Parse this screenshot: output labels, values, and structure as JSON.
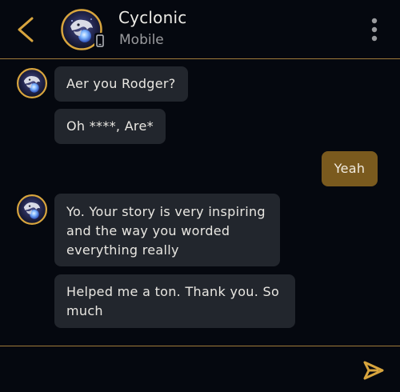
{
  "header": {
    "contact_name": "Cyclonic",
    "contact_status": "Mobile"
  },
  "messages": [
    {
      "direction": "in",
      "text": "Aer you Rodger?"
    },
    {
      "direction": "in",
      "text": "Oh ****, Are*"
    },
    {
      "direction": "out",
      "text": "Yeah"
    },
    {
      "direction": "in",
      "text": "Yo. Your story is very inspiring\nand the way you worded\neverything really"
    },
    {
      "direction": "in",
      "text": "Helped me a ton. Thank you. So\nmuch"
    }
  ],
  "composer": {
    "value": "",
    "placeholder": ""
  },
  "colors": {
    "background": "#05080f",
    "accent": "#d8a53e",
    "incoming_bubble": "#22262d",
    "outgoing_bubble": "#7a5a1e",
    "divider": "#a07a3a"
  },
  "icons": {
    "back": "chevron-left-icon",
    "avatar": "avatar-icon",
    "device": "mobile-device-icon",
    "menu": "more-vertical-icon",
    "send": "send-icon"
  }
}
